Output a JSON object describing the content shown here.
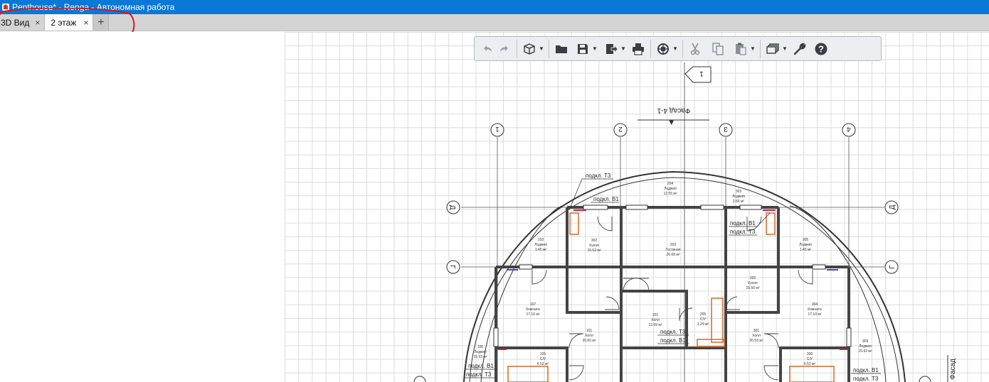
{
  "window": {
    "title": "Penthouse* - Renga - Автономная работа"
  },
  "tabs": [
    {
      "label": "3D Вид",
      "close": "×"
    },
    {
      "label": "2 этаж",
      "close": "×"
    }
  ],
  "tab_add": "+",
  "toolbar": {
    "buttons": [
      "undo-icon",
      "redo-icon",
      "view-cube-icon",
      "open-folder-icon",
      "save-icon",
      "export-icon",
      "print-icon",
      "orbit-icon",
      "cut-icon",
      "copy-icon",
      "paste-icon",
      "layers-icon",
      "settings-wrench-icon",
      "help-icon"
    ],
    "dropdown_arrow": "▼"
  },
  "plan": {
    "section_mark": "1",
    "facade_label": "Фасад 4-1",
    "side_label": "Фасад",
    "axes_x": [
      "1",
      "2",
      "3",
      "4"
    ],
    "axes_y": [
      "Д",
      "Г"
    ],
    "connection_labels": {
      "t3_top": "подкл. Т3",
      "b1_top": "подкл. В1",
      "b1_right": "подкл. В1",
      "t3_right": "подкл. Т3",
      "t3_center": "подкл. Т3",
      "b1_center": "подкл. В1",
      "b1_left": "подкл. В1",
      "t3_left": "подкл. Т3",
      "b1_far_right": "подкл. В1",
      "t3_far_right": "подкл. Т3"
    },
    "rooms": {
      "r204": {
        "num": "204",
        "name": "Лоджия",
        "area": "12.55 м²"
      },
      "r303": {
        "num": "303",
        "name": "Лоджия",
        "area": "2.66 м²"
      },
      "r103": {
        "num": "103",
        "name": "Лоджия",
        "area": "1.45 м²"
      },
      "r302": {
        "num": "302",
        "name": "Кухня",
        "area": "15.52 м²"
      },
      "r203": {
        "num": "203",
        "name": "Гостиная",
        "area": "26.68 м²"
      },
      "r305": {
        "num": "305",
        "name": "Лоджия",
        "area": "1.45 м²"
      },
      "r202": {
        "num": "202",
        "name": "Кухня",
        "area": "15.50 м²"
      },
      "r107": {
        "num": "107",
        "name": "Комната",
        "area": "17.10 м²"
      },
      "r304": {
        "num": "304",
        "name": "Комната",
        "area": "17.10 м²"
      },
      "r201": {
        "num": "201",
        "name": "Холл",
        "area": "12.99 м²"
      },
      "r205": {
        "num": "205",
        "name": "С/У",
        "area": "3.29 м²"
      },
      "r101": {
        "num": "101",
        "name": "Холл",
        "area": "20.60 м²"
      },
      "r301": {
        "num": "301",
        "name": "Холл",
        "area": "20.53 м²"
      },
      "r106": {
        "num": "106",
        "name": "Лоджия",
        "area": "15.93 м²"
      },
      "r105": {
        "num": "105",
        "name": "С/У",
        "area": "6.52 м²"
      },
      "r306": {
        "num": "306",
        "name": "С/У",
        "area": "6.52 м²"
      },
      "r309": {
        "num": "309",
        "name": "Лоджия",
        "area": "15.93 м²"
      }
    }
  }
}
